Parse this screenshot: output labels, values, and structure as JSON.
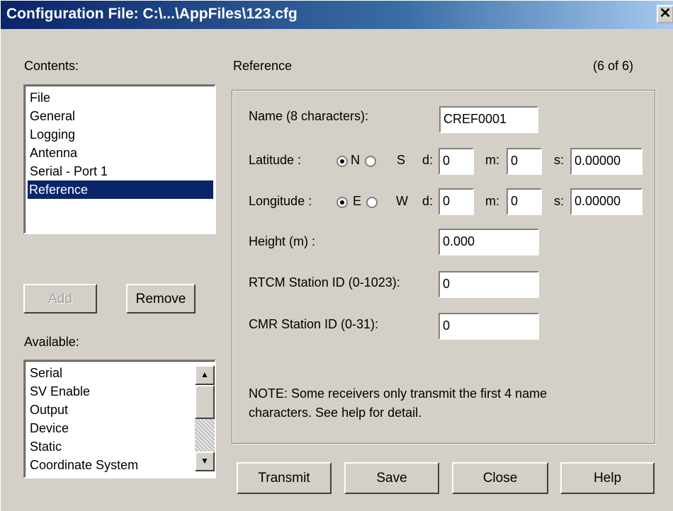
{
  "window": {
    "title": "Configuration File: C:\\...\\AppFiles\\123.cfg",
    "close_glyph": "✕"
  },
  "contents": {
    "label": "Contents:",
    "items": [
      "File",
      "General",
      "Logging",
      "Antenna",
      "Serial - Port 1",
      "Reference"
    ],
    "selected": "Reference"
  },
  "buttons": {
    "add": "Add",
    "remove": "Remove"
  },
  "available": {
    "label": "Available:",
    "items": [
      "Serial",
      "SV Enable",
      "Output",
      "Device",
      "Static",
      "Coordinate System"
    ]
  },
  "section": {
    "title": "Reference",
    "counter": "(6 of 6)"
  },
  "form": {
    "name_label": "Name (8 characters):",
    "name_value": "CREF0001",
    "latitude_label": "Latitude :",
    "lat_n": "N",
    "lat_s": "S",
    "lat_selected": "N",
    "longitude_label": "Longitude :",
    "lon_e": "E",
    "lon_w": "W",
    "lon_selected": "E",
    "d_label": "d:",
    "m_label": "m:",
    "s_label": "s:",
    "lat_d": "0",
    "lat_m": "0",
    "lat_s_value": "0.00000",
    "lon_d": "0",
    "lon_m": "0",
    "lon_s_value": "0.00000",
    "height_label": "Height (m) :",
    "height_value": "0.000",
    "rtcm_label": "RTCM Station ID (0-1023):",
    "rtcm_value": "0",
    "cmr_label": "CMR Station ID (0-31):",
    "cmr_value": "0",
    "note": "NOTE: Some receivers only transmit the first 4 name characters. See help for detail."
  },
  "footer": {
    "transmit": "Transmit",
    "save": "Save",
    "close": "Close",
    "help": "Help"
  },
  "icons": {
    "scroll_up": "▲",
    "scroll_down": "▼"
  }
}
